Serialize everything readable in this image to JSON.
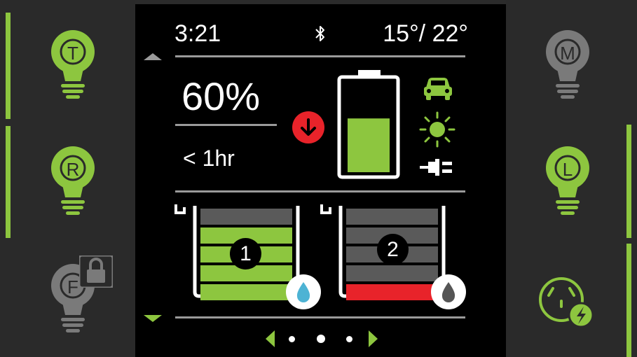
{
  "status": {
    "time": "3:21",
    "temperature": "15°/ 22°",
    "bluetooth_icon": "bluetooth-icon"
  },
  "battery": {
    "percent_label": "60%",
    "time_remaining": "< 1hr",
    "level": 0.6,
    "direction": "discharging",
    "fill_color": "#8dc63f"
  },
  "sources": [
    "car-icon",
    "sun-icon",
    "plug-icon"
  ],
  "tanks": [
    {
      "number": "1",
      "level": 4,
      "total": 5,
      "fill_color": "#8dc63f",
      "drop_color": "#4db3d4"
    },
    {
      "number": "2",
      "level": 1,
      "total": 5,
      "fill_color": "#e8232a",
      "drop_color": "#555555"
    }
  ],
  "lights": {
    "left": [
      {
        "letter": "T",
        "state": "on"
      },
      {
        "letter": "R",
        "state": "on"
      },
      {
        "letter": "F",
        "state": "locked"
      }
    ],
    "right": [
      {
        "letter": "M",
        "state": "off"
      },
      {
        "letter": "L",
        "state": "on"
      },
      {
        "letter": "",
        "state": "outlet-on"
      }
    ]
  },
  "pager": {
    "pages": 3,
    "current": 2
  },
  "colors": {
    "accent": "#8dc63f",
    "alert": "#e8232a",
    "off": "#7a7a7a"
  }
}
